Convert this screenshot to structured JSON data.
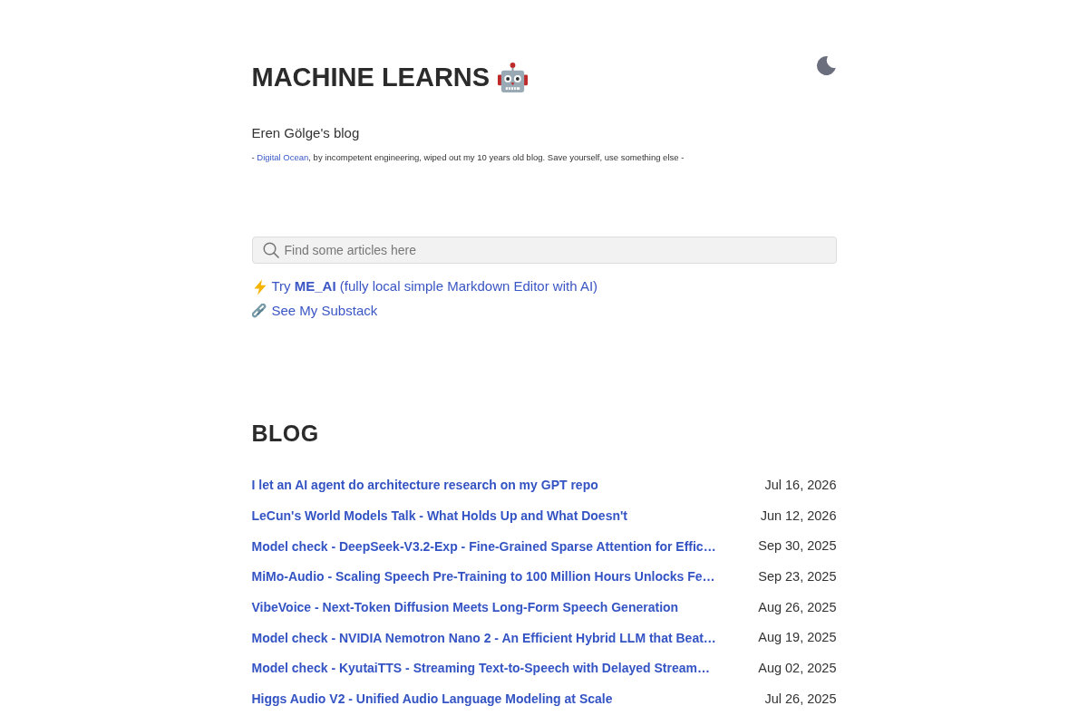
{
  "header": {
    "title": "MACHINE LEARNS",
    "subtitle": "Eren Gölge's blog",
    "note": {
      "prefix": "- ",
      "link": "Digital Ocean",
      "suffix": ", by incompetent engineering, wiped out my 10 years old blog. Save yourself, use something else -"
    }
  },
  "search": {
    "placeholder": "Find some articles here"
  },
  "links": [
    {
      "kind": "bolt",
      "text": "Try **ME_AI** (fully local simple Markdown Editor with AI)"
    },
    {
      "kind": "chain",
      "text": "See My Substack"
    }
  ],
  "blog": {
    "title": "BLOG",
    "posts": [
      {
        "title": "I let an AI agent do architecture research on my GPT repo",
        "date": "Jul 16, 2026"
      },
      {
        "title": "LeCun's World Models Talk - What Holds Up and What Doesn't",
        "date": "Jun 12, 2026"
      },
      {
        "title": "Model check - DeepSeek-V3.2-Exp - Fine-Grained Sparse Attention for Effic…",
        "date": "Sep 30, 2025"
      },
      {
        "title": "MiMo-Audio - Scaling Speech Pre-Training to 100 Million Hours Unlocks Fe…",
        "date": "Sep 23, 2025"
      },
      {
        "title": "VibeVoice - Next-Token Diffusion Meets Long-Form Speech Generation",
        "date": "Aug 26, 2025"
      },
      {
        "title": "Model check - NVIDIA Nemotron Nano 2 - An Efficient Hybrid LLM that Beat…",
        "date": "Aug 19, 2025"
      },
      {
        "title": "Model check - KyutaiTTS - Streaming Text-to-Speech with Delayed Stream…",
        "date": "Aug 02, 2025"
      },
      {
        "title": "Higgs Audio V2 - Unified Audio Language Modeling at Scale",
        "date": "Jul 26, 2025"
      }
    ]
  }
}
